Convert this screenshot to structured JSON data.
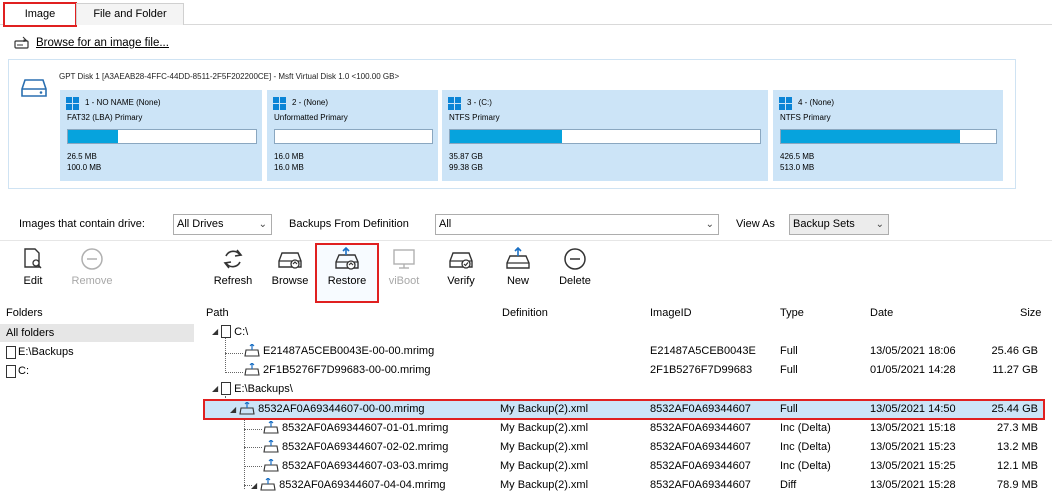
{
  "tabs": [
    {
      "label": "Image",
      "active": true
    },
    {
      "label": "File and Folder",
      "active": false
    }
  ],
  "browse": {
    "label": "Browse for an image file..."
  },
  "disk": {
    "title": "GPT Disk 1 [A3AEAB28-4FFC-44DD-8511-2F5F202200CE] - Msft   Virtual Disk   1.0  <100.00 GB>",
    "partitions": [
      {
        "name": "1 - NO NAME (None)",
        "type": "FAT32 (LBA) Primary",
        "used": "26.5 MB",
        "total": "100.0 MB",
        "fill": 0.265
      },
      {
        "name": "2 - (None)",
        "type": "Unformatted Primary",
        "used": "16.0 MB",
        "total": "16.0 MB",
        "fill": 0
      },
      {
        "name": "3 - (C:)",
        "type": "NTFS Primary",
        "used": "35.87 GB",
        "total": "99.38 GB",
        "fill": 0.361
      },
      {
        "name": "4 - (None)",
        "type": "NTFS Primary",
        "used": "426.5 MB",
        "total": "513.0 MB",
        "fill": 0.831
      }
    ]
  },
  "filters": {
    "contain_label": "Images that contain drive:",
    "contain_value": "All Drives",
    "definition_label": "Backups From Definition",
    "definition_value": "All",
    "view_label": "View As",
    "view_value": "Backup Sets"
  },
  "toolbar": {
    "edit": "Edit",
    "remove": "Remove",
    "refresh": "Refresh",
    "browse": "Browse",
    "restore": "Restore",
    "viboot": "viBoot",
    "verify": "Verify",
    "new": "New",
    "delete": "Delete"
  },
  "folders": {
    "header": "Folders",
    "all": "All folders",
    "items": [
      "E:\\Backups",
      "C:"
    ]
  },
  "columns": {
    "path": "Path",
    "definition": "Definition",
    "imageid": "ImageID",
    "type": "Type",
    "date": "Date",
    "size": "Size"
  },
  "groups": [
    {
      "label": "C:\\"
    },
    {
      "label": "E:\\Backups\\"
    }
  ],
  "rows": [
    {
      "path": "E21487A5CEB0043E-00-00.mrimg",
      "definition": "",
      "imageid": "E21487A5CEB0043E",
      "type": "Full",
      "date": "13/05/2021 18:06",
      "size": "25.46 GB"
    },
    {
      "path": "2F1B5276F7D99683-00-00.mrimg",
      "definition": "",
      "imageid": "2F1B5276F7D99683",
      "type": "Full",
      "date": "01/05/2021 14:28",
      "size": "11.27 GB"
    },
    {
      "path": "8532AF0A69344607-00-00.mrimg",
      "definition": "My Backup(2).xml",
      "imageid": "8532AF0A69344607",
      "type": "Full",
      "date": "13/05/2021 14:50",
      "size": "25.44 GB"
    },
    {
      "path": "8532AF0A69344607-01-01.mrimg",
      "definition": "My Backup(2).xml",
      "imageid": "8532AF0A69344607",
      "type": "Inc (Delta)",
      "date": "13/05/2021 15:18",
      "size": "27.3 MB"
    },
    {
      "path": "8532AF0A69344607-02-02.mrimg",
      "definition": "My Backup(2).xml",
      "imageid": "8532AF0A69344607",
      "type": "Inc (Delta)",
      "date": "13/05/2021 15:23",
      "size": "13.2 MB"
    },
    {
      "path": "8532AF0A69344607-03-03.mrimg",
      "definition": "My Backup(2).xml",
      "imageid": "8532AF0A69344607",
      "type": "Inc (Delta)",
      "date": "13/05/2021 15:25",
      "size": "12.1 MB"
    },
    {
      "path": "8532AF0A69344607-04-04.mrimg",
      "definition": "My Backup(2).xml",
      "imageid": "8532AF0A69344607",
      "type": "Diff",
      "date": "13/05/2021 15:28",
      "size": "78.9 MB"
    }
  ]
}
